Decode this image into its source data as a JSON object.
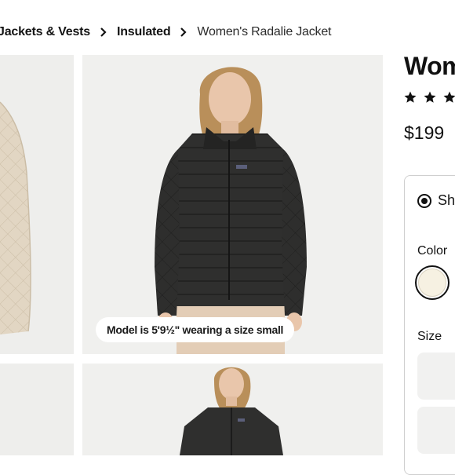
{
  "breadcrumb": {
    "items": [
      "Jackets & Vests",
      "Insulated",
      "Women's Radalie Jacket"
    ]
  },
  "gallery": {
    "caption": "Model is 5'9½\" wearing a size small"
  },
  "product": {
    "title": "Wom",
    "rating_stars": 3,
    "price": "$199",
    "shipping_option": "Sh",
    "color_label": "Color",
    "size_label": "Size",
    "selected_color_hex": "#f6f1e2"
  },
  "colors": {
    "jacket_black": "#2b2b2a",
    "jacket_natural": "#e2d6c3",
    "tile_bg": "#f0f0ee"
  }
}
